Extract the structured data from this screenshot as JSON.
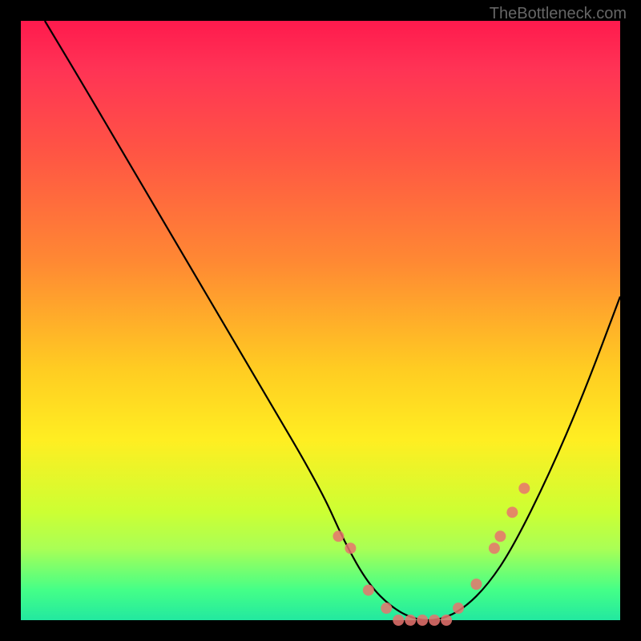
{
  "watermark": "TheBottleneck.com",
  "chart_data": {
    "type": "line",
    "title": "",
    "xlabel": "",
    "ylabel": "",
    "xlim": [
      0,
      100
    ],
    "ylim": [
      0,
      100
    ],
    "series": [
      {
        "name": "curve",
        "x": [
          4,
          10,
          20,
          30,
          40,
          50,
          54,
          58,
          62,
          66,
          70,
          74,
          78,
          82,
          88,
          94,
          100
        ],
        "y": [
          100,
          90,
          73,
          56,
          39,
          22,
          13,
          6,
          2,
          0,
          0,
          2,
          6,
          12,
          24,
          38,
          54
        ]
      }
    ],
    "scatter_overlay": {
      "name": "highlight-dots",
      "x": [
        53,
        55,
        58,
        61,
        63,
        65,
        67,
        69,
        71,
        73,
        76,
        79,
        80,
        82,
        84
      ],
      "y": [
        14,
        12,
        5,
        2,
        0,
        0,
        0,
        0,
        0,
        2,
        6,
        12,
        14,
        18,
        22
      ]
    },
    "gradient_bands": [
      {
        "color": "#ff1a4d",
        "stop": 0
      },
      {
        "color": "#ffee22",
        "stop": 70
      },
      {
        "color": "#22e8a0",
        "stop": 100
      }
    ]
  }
}
